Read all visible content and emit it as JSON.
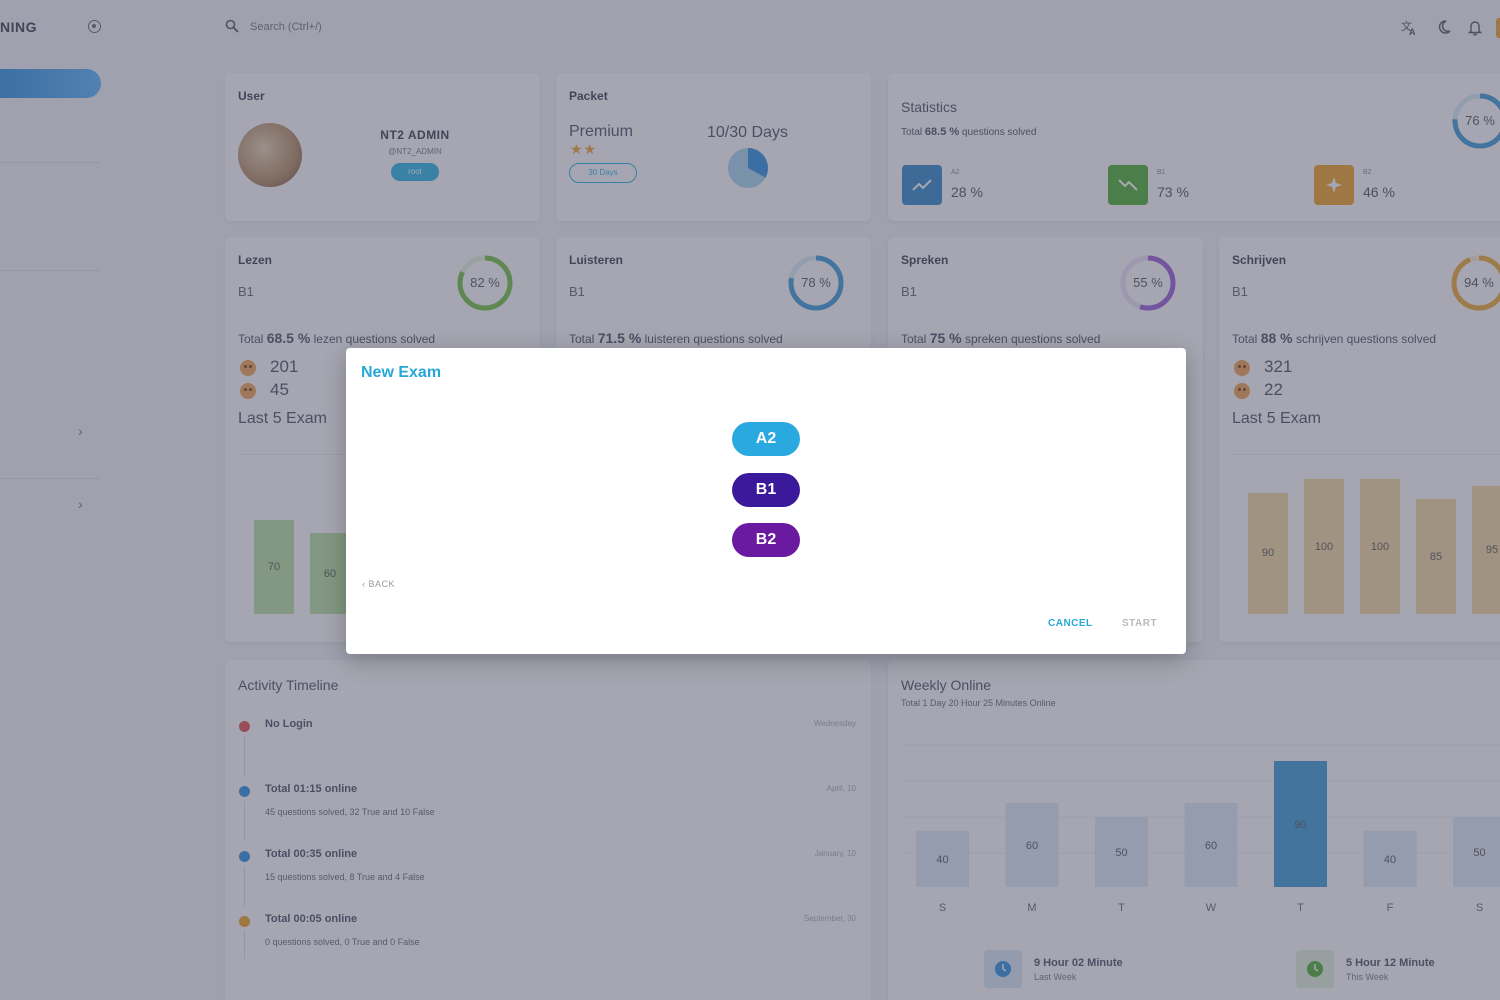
{
  "sidebar": {
    "brand": "NING"
  },
  "search": {
    "placeholder": "Search (Ctrl+/)"
  },
  "user_card": {
    "title": "User",
    "name": "NT2 ADMIN",
    "handle": "@NT2_ADMIN",
    "role": "root"
  },
  "packet_card": {
    "title": "Packet",
    "plan": "Premium",
    "stars": "★★",
    "duration": "30 Days",
    "days": "10/30 Days",
    "days_fraction": 0.33
  },
  "statistics": {
    "title": "Statistics",
    "subtitle_prefix": "Total ",
    "subtitle_value": "68.5 %",
    "subtitle_suffix": " questions solved",
    "overall": "76 %",
    "overall_value": 76,
    "items": [
      {
        "level": "A2",
        "value": "28 %",
        "color": "#2f86c9"
      },
      {
        "level": "B1",
        "value": "73 %",
        "color": "#4caf30"
      },
      {
        "level": "B2",
        "value": "46 %",
        "color": "#f0a020"
      }
    ]
  },
  "skills": [
    {
      "name": "Lezen",
      "level": "B1",
      "percent": "82 %",
      "percent_value": 82,
      "ring_color": "#72c040",
      "total": "68.5 %",
      "topic": "lezen",
      "happy": "201",
      "sad": "45",
      "last": "Last 5 Exam",
      "bars": [
        70,
        60
      ],
      "bar_color": "#b9e2a0"
    },
    {
      "name": "Luisteren",
      "level": "B1",
      "percent": "78 %",
      "percent_value": 78,
      "ring_color": "#3a9ad8",
      "total": "71.5 %",
      "topic": "luisteren",
      "happy": "",
      "sad": "",
      "last": "",
      "bars": [],
      "bar_color": "#a8d4f0"
    },
    {
      "name": "Spreken",
      "level": "B1",
      "percent": "55 %",
      "percent_value": 55,
      "ring_color": "#9a5ad8",
      "total": "75 %",
      "topic": "spreken",
      "happy": "",
      "sad": "",
      "last": "",
      "bars": [],
      "bar_color": "#c8a8f0"
    },
    {
      "name": "Schrijven",
      "level": "B1",
      "percent": "94 %",
      "percent_value": 94,
      "ring_color": "#f0a830",
      "total": "88 %",
      "topic": "schrijven",
      "happy": "321",
      "sad": "22",
      "last": "Last 5 Exam",
      "bars": [
        90,
        100,
        100,
        85,
        95
      ],
      "bar_color": "#f6d8a0"
    }
  ],
  "skill_labels": {
    "total_prefix": "Total ",
    "questions_solved": "questions solved"
  },
  "activity": {
    "title": "Activity Timeline",
    "items": [
      {
        "title": "No Login",
        "desc": "",
        "date": "Wednesday",
        "color": "#e0504a"
      },
      {
        "title": "Total 01:15 online",
        "desc": "45 questions solved, 32 True and 10 False",
        "date": "April, 10",
        "color": "#2a8fe0"
      },
      {
        "title": "Total 00:35 online",
        "desc": "15 questions solved, 8 True and 4 False",
        "date": "January, 10",
        "color": "#2a8fe0"
      },
      {
        "title": "Total 00:05 online",
        "desc": "0 questions solved, 0 True and 0 False",
        "date": "September, 30",
        "color": "#f0a020"
      }
    ]
  },
  "weekly": {
    "title": "Weekly Online",
    "subtitle": "Total 1 Day 20 Hour 25 Minutes Online",
    "days": [
      "S",
      "M",
      "T",
      "W",
      "T",
      "F",
      "S"
    ],
    "values": [
      40,
      60,
      50,
      60,
      90,
      40,
      50
    ],
    "highlight_index": 4,
    "last_week": {
      "title": "9 Hour 02 Minute",
      "sub": "Last Week"
    },
    "this_week": {
      "title": "5 Hour 12 Minute",
      "sub": "This Week"
    }
  },
  "modal": {
    "title": "New Exam",
    "levels": [
      {
        "label": "A2",
        "color": "#2aa8e0"
      },
      {
        "label": "B1",
        "color": "#3a1a9a"
      },
      {
        "label": "B2",
        "color": "#6a1aa0"
      }
    ],
    "back": "BACK",
    "cancel": "CANCEL",
    "start": "START"
  }
}
